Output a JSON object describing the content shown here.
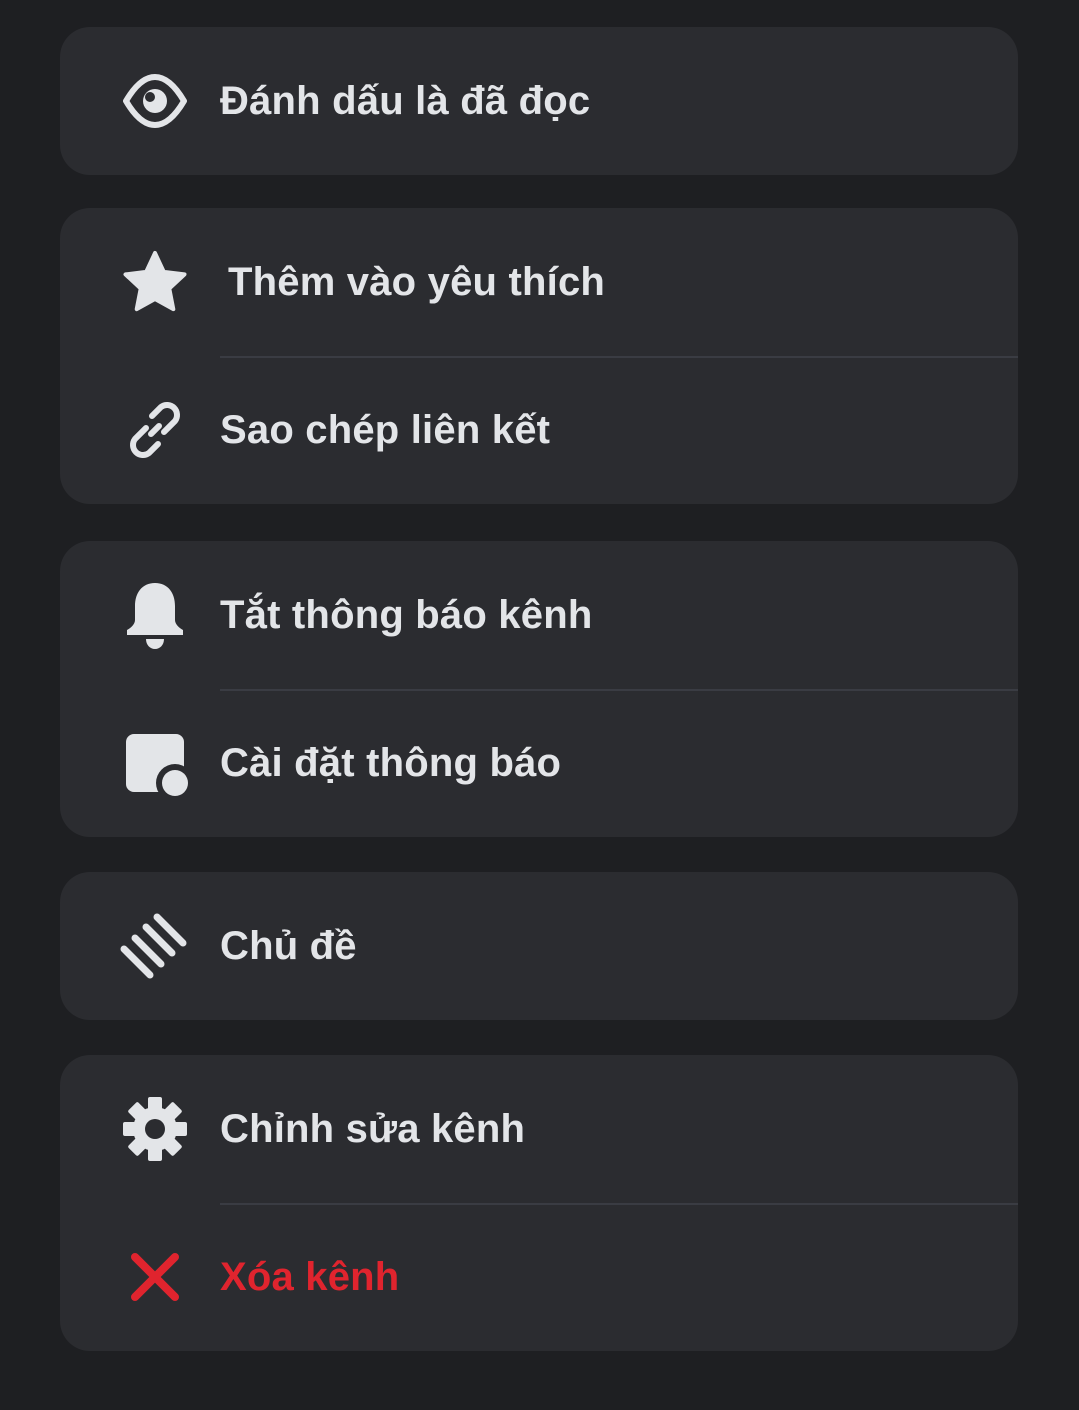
{
  "menu": {
    "groups": [
      {
        "items": [
          {
            "label": "Đánh dấu là đã đọc",
            "icon": "eye-icon"
          }
        ]
      },
      {
        "items": [
          {
            "label": "Thêm vào yêu thích",
            "icon": "star-icon"
          },
          {
            "label": "Sao chép liên kết",
            "icon": "link-icon"
          }
        ]
      },
      {
        "items": [
          {
            "label": "Tắt thông báo kênh",
            "icon": "bell-icon"
          },
          {
            "label": "Cài đặt thông báo",
            "icon": "notification-settings-icon"
          }
        ]
      },
      {
        "items": [
          {
            "label": "Chủ đề",
            "icon": "threads-icon"
          }
        ]
      },
      {
        "items": [
          {
            "label": "Chỉnh sửa kênh",
            "icon": "gear-icon"
          },
          {
            "label": "Xóa kênh",
            "icon": "close-icon",
            "danger": true
          }
        ]
      }
    ]
  },
  "colors": {
    "background": "#1e1f22",
    "card": "#2b2c30",
    "text": "#e3e5e8",
    "icon": "#e3e5e8",
    "danger": "#e0242e",
    "divider": "#3a3c43"
  }
}
